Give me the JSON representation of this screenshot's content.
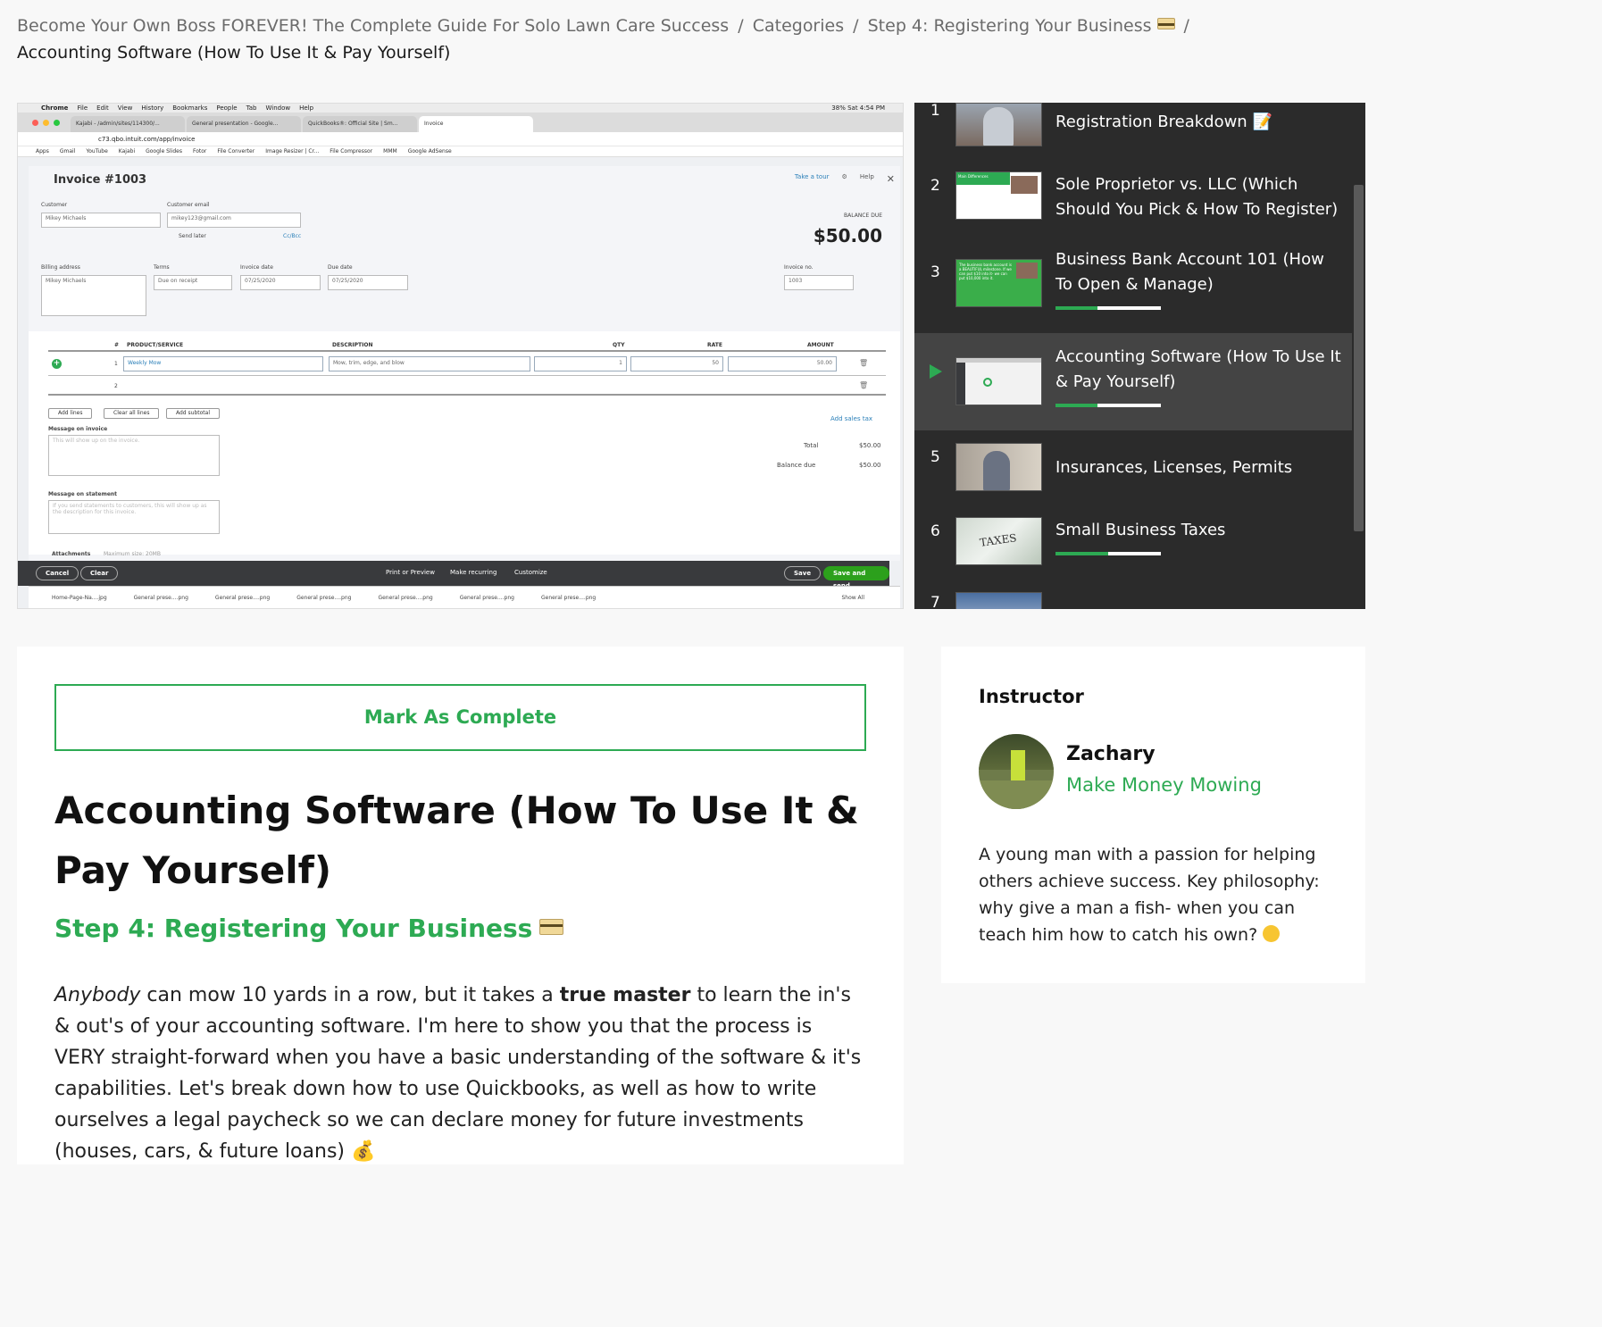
{
  "breadcrumb": {
    "course": "Become Your Own Boss FOREVER! The Complete Guide For Solo Lawn Care Success",
    "categories": "Categories",
    "section": "Step 4: Registering Your Business",
    "separator": "/",
    "current": "Accounting Software (How To Use It & Pay Yourself)"
  },
  "video": {
    "mac_menu": [
      "Chrome",
      "File",
      "Edit",
      "View",
      "History",
      "Bookmarks",
      "People",
      "Tab",
      "Window",
      "Help"
    ],
    "mac_status": "38%  Sat 4:54 PM",
    "tabs": [
      "Kajabi - /admin/sites/114300/...",
      "General presentation - Google...",
      "QuickBooks®: Official Site | Sm...",
      "Invoice"
    ],
    "url": "c73.qbo.intuit.com/app/invoice",
    "bookmarks": [
      "Apps",
      "Gmail",
      "YouTube",
      "Kajabi",
      "Google Slides",
      "Fotor",
      "File Converter",
      "Image Resizer | Cr...",
      "File Compressor",
      "MMM",
      "Google AdSense"
    ],
    "invoice_title": "Invoice #1003",
    "tools": [
      "Take a tour",
      "Help"
    ],
    "customer_label": "Customer",
    "customer_value": "Mikey Michaels",
    "email_label": "Customer email",
    "email_value": "mikey123@gmail.com",
    "send_later": "Send later",
    "cc_bcc": "Cc/Bcc",
    "balance_label": "BALANCE DUE",
    "balance_value": "$50.00",
    "billing_label": "Billing address",
    "billing_value": "Mikey Michaels",
    "terms_label": "Terms",
    "terms_value": "Due on receipt",
    "invoice_date_label": "Invoice date",
    "invoice_date_value": "07/25/2020",
    "due_date_label": "Due date",
    "due_date_value": "07/25/2020",
    "invoice_no_label": "Invoice no.",
    "invoice_no_value": "1003",
    "columns": [
      "#",
      "PRODUCT/SERVICE",
      "DESCRIPTION",
      "QTY",
      "RATE",
      "AMOUNT"
    ],
    "line1": {
      "num": "1",
      "product": "Weekly Mow",
      "description": "Mow, trim, edge, and blow",
      "qty": "1",
      "rate": "50",
      "amount": "50.00"
    },
    "line2_num": "2",
    "buttons": [
      "Add lines",
      "Clear all lines",
      "Add subtotal"
    ],
    "add_sales_tax": "Add sales tax",
    "message_invoice_label": "Message on invoice",
    "message_invoice_placeholder": "This will show up on the invoice.",
    "message_statement_label": "Message on statement",
    "message_statement_placeholder": "If you send statements to customers, this will show up as the description for this invoice.",
    "total_label": "Total",
    "total_value": "$50.00",
    "balance_due_label": "Balance due",
    "balance_due_value": "$50.00",
    "attachments": "Attachments",
    "max_size": "Maximum size: 20MB",
    "footer": {
      "cancel": "Cancel",
      "clear": "Clear",
      "print": "Print or Preview",
      "recurring": "Make recurring",
      "customize": "Customize",
      "save": "Save",
      "save_send": "Save and send"
    },
    "downloads": [
      "Home-Page-Na....jpg",
      "General prese....png",
      "General prese....png",
      "General prese....png",
      "General prese....png",
      "General prese....png",
      "General prese....png"
    ],
    "show_all": "Show All"
  },
  "playlist": [
    {
      "num": "1",
      "title": "Registration Breakdown 📝",
      "progress": null,
      "active": false
    },
    {
      "num": "2",
      "title": "Sole Proprietor vs. LLC (Which Should You Pick & How To Register)",
      "progress": null,
      "active": false
    },
    {
      "num": "3",
      "title": "Business Bank Account 101 (How To Open & Manage)",
      "progress": 0.4,
      "active": false
    },
    {
      "num": "4",
      "title": "Accounting Software (How To Use It & Pay Yourself)",
      "progress": 0.4,
      "active": true
    },
    {
      "num": "5",
      "title": "Insurances, Licenses, Permits",
      "progress": null,
      "active": false
    },
    {
      "num": "6",
      "title": "Small Business Taxes",
      "progress": 0.5,
      "active": false
    },
    {
      "num": "7",
      "title": "",
      "progress": null,
      "active": false
    }
  ],
  "thumb_text": {
    "t2": "Main Differences",
    "t3": "The business bank account is a BEAUTIFUL milestone. If we can put $10 into it- we can put $10,000 into it.",
    "t6": "TAXES"
  },
  "lesson": {
    "mark_complete": "Mark As Complete",
    "title": "Accounting Software (How To Use It & Pay Yourself)",
    "step": "Step 4: Registering Your Business",
    "desc_italic": "Anybody",
    "desc_part1": " can mow 10 yards in a row, but it takes a ",
    "desc_bold": "true master",
    "desc_part2": " to learn the in's & out's of your accounting software. I'm here to show you that the process is VERY straight-forward when you have a basic understanding of the software & it's capabilities. Let's break down how to use Quickbooks, as well as how to write ourselves a legal paycheck so we can declare money for future investments (houses, cars, & future loans) 💰"
  },
  "instructor": {
    "heading": "Instructor",
    "name": "Zachary",
    "brand": "Make Money Mowing",
    "bio": "A young man with a passion for helping others achieve success. Key philosophy: why give a man a fish- when you can teach him how to catch his own? "
  },
  "colors": {
    "accent": "#2daa53",
    "playlist_bg": "#2b2b2b",
    "playlist_active": "#444444"
  }
}
